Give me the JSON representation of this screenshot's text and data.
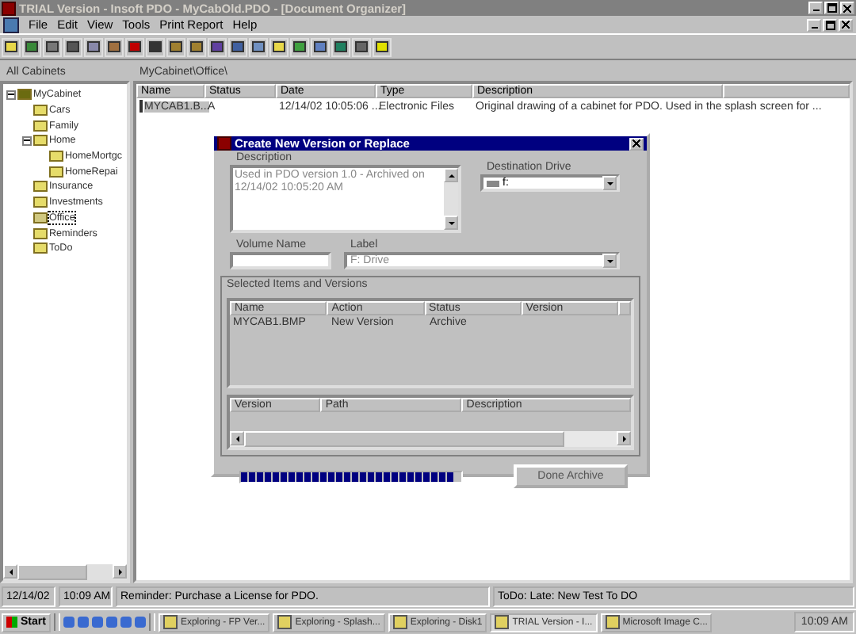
{
  "window": {
    "title": "TRIAL Version - Insoft PDO - MyCabOld.PDO - [Document Organizer]"
  },
  "menu": [
    "File",
    "Edit",
    "View",
    "Tools",
    "Print Report",
    "Help"
  ],
  "sidebar": {
    "header": "All Cabinets",
    "tree": [
      {
        "label": "MyCabinet",
        "selected": false,
        "expanded": true,
        "children": [
          {
            "label": "Cars",
            "selected": false
          },
          {
            "label": "Family",
            "selected": false
          },
          {
            "label": "Home",
            "selected": false,
            "expanded": true,
            "children": [
              {
                "label": "HomeMortgc",
                "selected": false
              },
              {
                "label": "HomeRepai",
                "selected": false
              }
            ]
          },
          {
            "label": "Insurance",
            "selected": false
          },
          {
            "label": "Investments",
            "selected": false
          },
          {
            "label": "Office",
            "selected": true
          },
          {
            "label": "Reminders",
            "selected": false
          },
          {
            "label": "ToDo",
            "selected": false
          }
        ]
      }
    ]
  },
  "path": "MyCabinet\\Office\\",
  "table": {
    "columns": [
      "Name",
      "Status",
      "Date",
      "Type",
      "Description"
    ],
    "rows": [
      {
        "selected": true,
        "cells": [
          "MYCAB1.B...",
          "A",
          "12/14/02 10:05:06 ...",
          "Electronic Files",
          "Original drawing of a cabinet for PDO.  Used in the splash screen for ..."
        ]
      }
    ]
  },
  "dialog": {
    "title": "Create New Version or Replace",
    "description_label": "Description",
    "description": "Used in PDO version 1.0 - Archived on 12/14/02 10:05:20 AM",
    "drive_label": "Destination Drive",
    "drive": "f:",
    "volume_label": "Volume Name",
    "label_label": "Label",
    "label_value": "F: Drive",
    "group_title": "Selected Items and Versions",
    "items_columns": [
      "Name",
      "Action",
      "Status",
      "Version"
    ],
    "items_rows": [
      [
        "MYCAB1.BMP",
        "New Version",
        "Archive",
        ""
      ]
    ],
    "versions_columns": [
      "Version",
      "Path",
      "Description"
    ],
    "progress": {
      "level": 0.97
    },
    "button": "Done Archive"
  },
  "status_bar": [
    "12/14/02",
    "10:09 AM",
    "Reminder: Purchase a License for PDO.",
    "ToDo: Late:  New Test To DO"
  ],
  "taskbar": {
    "start": "Start",
    "tasks": [
      {
        "label": "Exploring - FP Ver...",
        "selected": false
      },
      {
        "label": "Exploring - Splash...",
        "selected": false
      },
      {
        "label": "Exploring - Disk1",
        "selected": false
      },
      {
        "label": "TRIAL Version - I...",
        "selected": true
      },
      {
        "label": "Microsoft Image C...",
        "selected": false
      }
    ],
    "clock": "10:09 AM"
  }
}
